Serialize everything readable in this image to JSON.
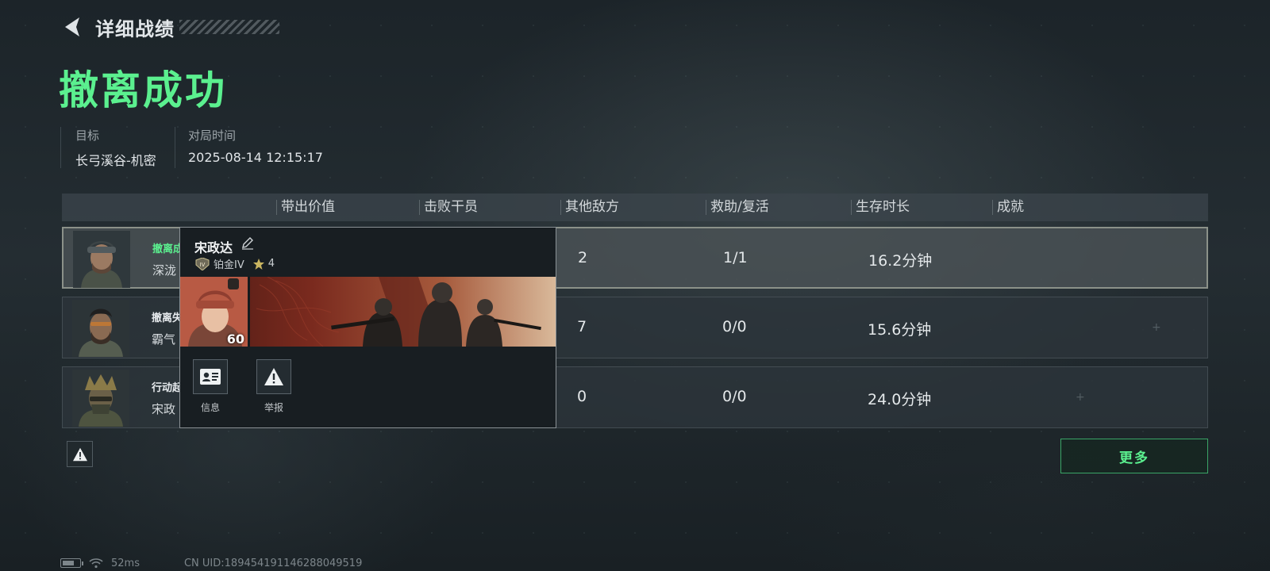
{
  "header": {
    "title": "详细战绩",
    "result": "撤离成功"
  },
  "meta": {
    "target_label": "目标",
    "target_value": "长弓溪谷-机密",
    "time_label": "对局时间",
    "time_value": "2025-08-14 12:15:17"
  },
  "table": {
    "headers": [
      "带出价值",
      "击败干员",
      "其他敌方",
      "救助/复活",
      "生存时长",
      "成就"
    ],
    "rows": [
      {
        "status": "撤离成",
        "name": "深泷",
        "other_enemies": "2",
        "assist": "1/1",
        "survival": "16.2分钟"
      },
      {
        "status": "撤离失",
        "name": "霸气",
        "other_enemies": "7",
        "assist": "0/0",
        "survival": "15.6分钟"
      },
      {
        "status": "行动起",
        "name": "宋政",
        "other_enemies": "0",
        "assist": "0/0",
        "survival": "24.0分钟"
      }
    ]
  },
  "popup": {
    "player_name": "宋政达",
    "rank_badge": "IV",
    "rank": "铂金IV",
    "stars": "4",
    "level": "60",
    "info_label": "信息",
    "report_label": "举报"
  },
  "actions": {
    "more_label": "更多"
  },
  "status_bar": {
    "ping": "52ms",
    "uid": "CN UID:189454191146288049519"
  },
  "colors": {
    "accent_green": "#5bf08f",
    "background": "#1a2126"
  }
}
